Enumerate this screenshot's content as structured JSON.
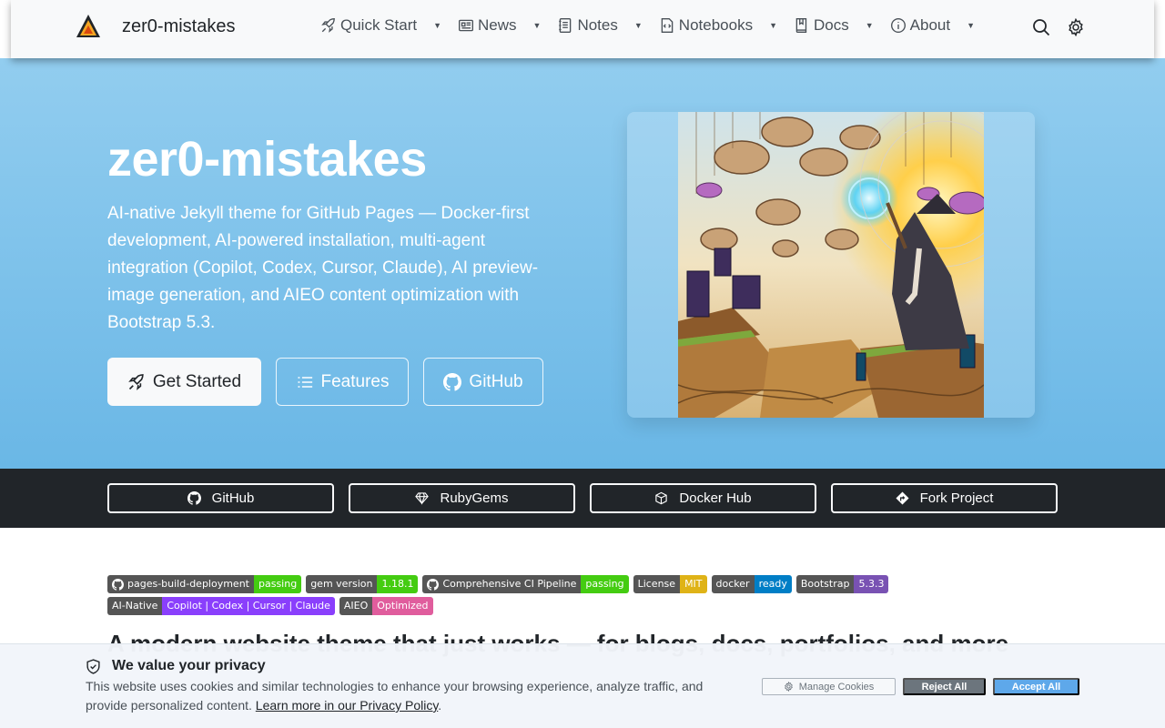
{
  "navbar": {
    "brand_name": "zer0-mistakes",
    "items": [
      {
        "label": "Quick Start",
        "icon": "rocket-icon"
      },
      {
        "label": "News",
        "icon": "newspaper-icon"
      },
      {
        "label": "Notes",
        "icon": "journal-icon"
      },
      {
        "label": "Notebooks",
        "icon": "code-file-icon"
      },
      {
        "label": "Docs",
        "icon": "book-icon"
      },
      {
        "label": "About",
        "icon": "info-icon"
      }
    ],
    "tools": [
      "search-icon",
      "gear-icon"
    ]
  },
  "hero": {
    "title": "zer0-mistakes",
    "lead": "AI-native Jekyll theme for GitHub Pages — Docker-first development, AI-powered installation, multi-agent integration (Copilot, Codex, Cursor, Claude), AI preview-image generation, and AIEO content optimization with Bootstrap 5.3.",
    "buttons": {
      "get_started": "Get Started",
      "features": "Features",
      "github": "GitHub"
    },
    "image_icon": "wizard-illustration"
  },
  "strip": {
    "buttons": [
      {
        "label": "GitHub",
        "icon": "github-icon"
      },
      {
        "label": "RubyGems",
        "icon": "gem-icon"
      },
      {
        "label": "Docker Hub",
        "icon": "box-icon"
      },
      {
        "label": "Fork Project",
        "icon": "fork-icon"
      }
    ]
  },
  "badges": {
    "row1": [
      {
        "label": "pages-build-deployment",
        "value": "passing",
        "color": "#4c1",
        "github": true
      },
      {
        "label": "gem version",
        "value": "1.18.1",
        "color": "#4c1",
        "github": false
      },
      {
        "label": "Comprehensive CI Pipeline",
        "value": "passing",
        "color": "#4c1",
        "github": true
      },
      {
        "label": "License",
        "value": "MIT",
        "color": "#dfb317",
        "github": false
      },
      {
        "label": "docker",
        "value": "ready",
        "color": "#007ec6",
        "github": false
      },
      {
        "label": "Bootstrap",
        "value": "5.3.3",
        "color": "#7952b3",
        "github": false
      }
    ],
    "row2": [
      {
        "label": "AI-Native",
        "value": "Copilot | Codex | Cursor | Claude",
        "color": "#8a3ffc",
        "github": false
      },
      {
        "label": "AIEO",
        "value": "Optimized",
        "color": "#e05d9d",
        "github": false
      }
    ]
  },
  "section_heading": "A modern website theme that just works — for blogs, docs, portfolios, and more",
  "cookie": {
    "title": "We value your privacy",
    "text": "This website uses cookies and similar technologies to enhance your browsing experience, analyze traffic, and provide personalized content.",
    "link": "Learn more in our Privacy Policy",
    "manage": "Manage Cookies",
    "reject": "Reject All",
    "accept": "Accept All"
  },
  "colors": {
    "hero_top": "#92cdef",
    "hero_bottom": "#6ab7e6",
    "strip_bg": "#212529",
    "accept": "#5ea8ea"
  }
}
